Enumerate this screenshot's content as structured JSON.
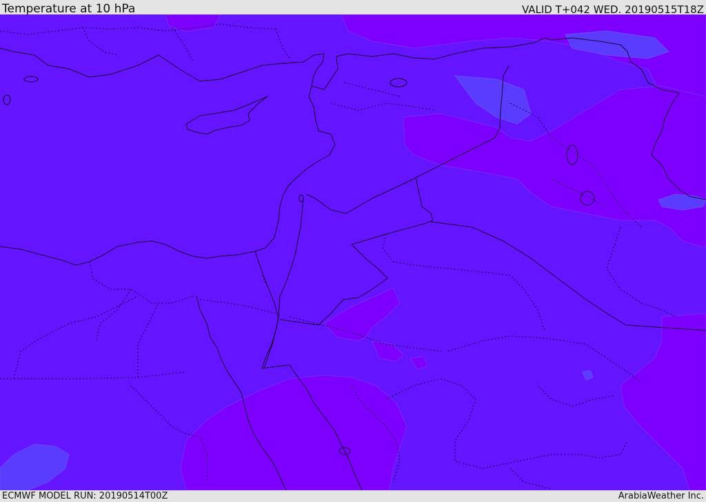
{
  "header": {
    "title": "Temperature at 10 hPa",
    "valid": "VALID T+042 WED. 20190515T18Z"
  },
  "footer": {
    "model_run": "ECMWF MODEL RUN: 20190514T00Z",
    "credit": "ArabiaWeather Inc."
  },
  "colors": {
    "base_field": "#6414ff",
    "warm_field": "#7d00ff",
    "cool_field": "#5a3cff",
    "boundary_line": "#1a0033",
    "background": "#e4e4e4"
  }
}
